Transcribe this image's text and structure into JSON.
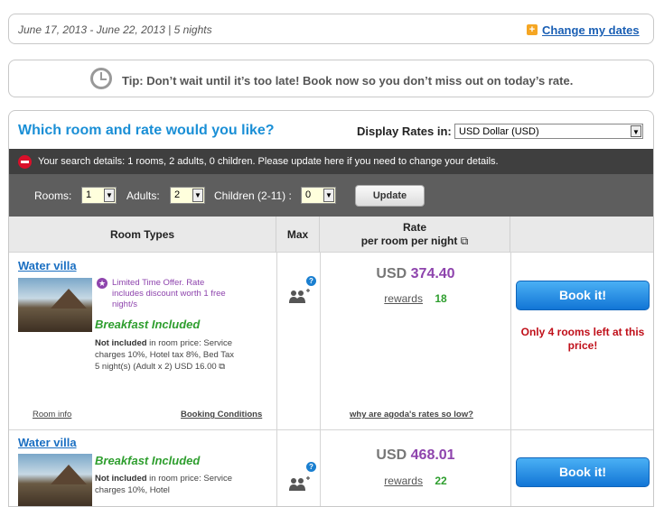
{
  "dates": {
    "range": "June 17, 2013 - June 22, 2013 | 5 nights",
    "change_link": "Change my dates"
  },
  "tip": {
    "text": "Tip: Don’t wait until it’s too late! Book now so you don’t miss out on today’s rate."
  },
  "rooms_panel": {
    "question": "Which room and rate would you like?",
    "display_rates_label": "Display Rates in:",
    "currency_value": "USD Dollar (USD)",
    "search_details": "Your search details: 1 rooms, 2 adults, 0 children. Please update here if you need to change your details.",
    "rooms_label": "Rooms:",
    "rooms_value": "1",
    "adults_label": "Adults:",
    "adults_value": "2",
    "children_label": "Children (2-11) :",
    "children_value": "0",
    "update_label": "Update"
  },
  "table_header": {
    "room_types": "Room Types",
    "max": "Max",
    "rate_line1": "Rate",
    "rate_line2": "per room per night"
  },
  "rooms": [
    {
      "name": "Water villa",
      "offer_text": "Limited Time Offer. Rate includes discount worth 1 free night/s",
      "breakfast": "Breakfast Included",
      "not_included_bold": "Not included",
      "not_included_rest": " in room price: Service charges 10%, Hotel tax 8%, Bed Tax 5 night(s) (Adult x 2) USD 16.00",
      "room_info": "Room info",
      "booking_conditions": "Booking Conditions",
      "currency": "USD",
      "price": "374.40",
      "rewards_label": "rewards",
      "rewards_points": "18",
      "book_label": "Book it!",
      "availability": "Only 4 rooms left at this price!",
      "why_link": "why are agoda's rates so low?"
    },
    {
      "name": "Water villa",
      "breakfast": "Breakfast Included",
      "not_included_bold": "Not included",
      "not_included_rest": " in room price: Service charges 10%, Hotel",
      "currency": "USD",
      "price": "468.01",
      "rewards_label": "rewards",
      "rewards_points": "22",
      "book_label": "Book it!"
    }
  ],
  "colors": {
    "link_blue": "#1a6fc2",
    "price_purple": "#8e44ad",
    "green": "#2e9e2e",
    "book_blue": "#1a8fd6",
    "alert_red": "#c0101a"
  }
}
